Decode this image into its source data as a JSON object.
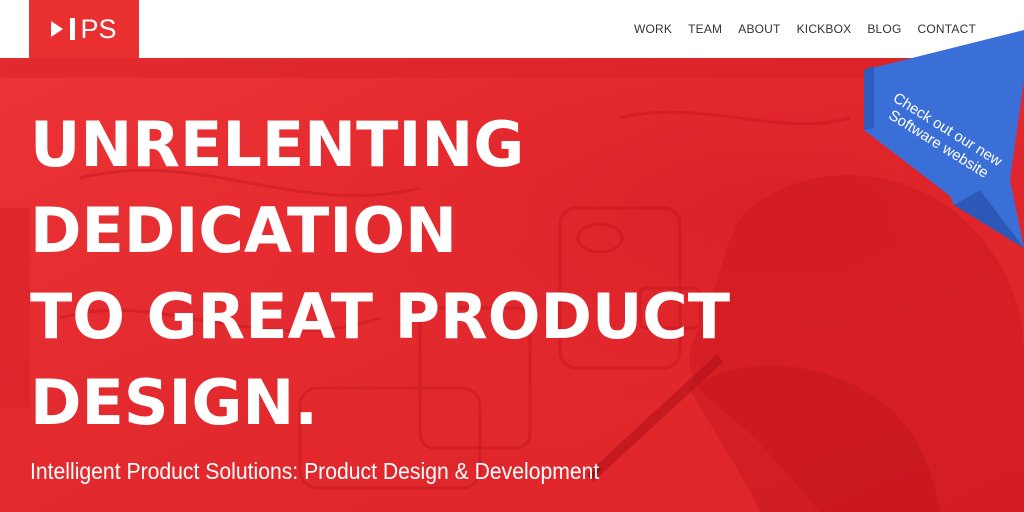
{
  "header": {
    "logo_text": "PS",
    "nav": [
      "WORK",
      "TEAM",
      "ABOUT",
      "KICKBOX",
      "BLOG",
      "CONTACT"
    ]
  },
  "hero": {
    "headline": [
      "UNRELENTING",
      "DEDICATION",
      "TO GREAT PRODUCT",
      "DESIGN."
    ],
    "subheadline": "Intelligent Product Solutions: Product Design & Development"
  },
  "ribbon": {
    "lines": [
      "Check out our new",
      "Software website"
    ]
  },
  "colors": {
    "brand_red": "#ea2f30",
    "ribbon_blue": "#3b6fd8",
    "nav_text": "#333333"
  }
}
